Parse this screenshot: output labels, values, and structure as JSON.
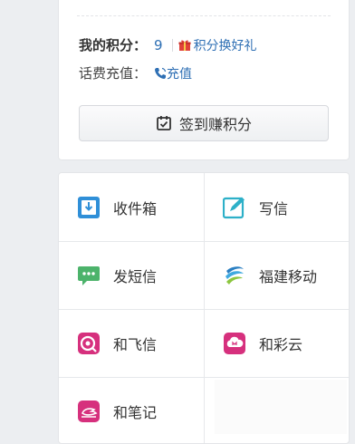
{
  "top_card": {
    "faded_text": "",
    "points_label": "我的积分：",
    "points_value": "9",
    "redeem_link": "积分换好礼",
    "recharge_label": "话费充值：",
    "recharge_link": "充值",
    "checkin_button": "签到赚积分"
  },
  "grid": {
    "items": [
      {
        "label": "收件箱",
        "icon": "inbox-icon",
        "color": "#2f8fd8"
      },
      {
        "label": "写信",
        "icon": "compose-icon",
        "color": "#2db0c8"
      },
      {
        "label": "发短信",
        "icon": "sms-icon",
        "color": "#4cb36b"
      },
      {
        "label": "福建移动",
        "icon": "china-mobile-icon",
        "color": "#2a7fc2"
      },
      {
        "label": "和飞信",
        "icon": "fetion-icon",
        "color": "#d6307d"
      },
      {
        "label": "和彩云",
        "icon": "cloud-icon",
        "color": "#d6307d"
      },
      {
        "label": "和笔记",
        "icon": "note-icon",
        "color": "#d6307d"
      }
    ]
  },
  "colors": {
    "link_blue": "#2e6fb4",
    "gift_red": "#e0413a",
    "background": "#eceef1"
  }
}
